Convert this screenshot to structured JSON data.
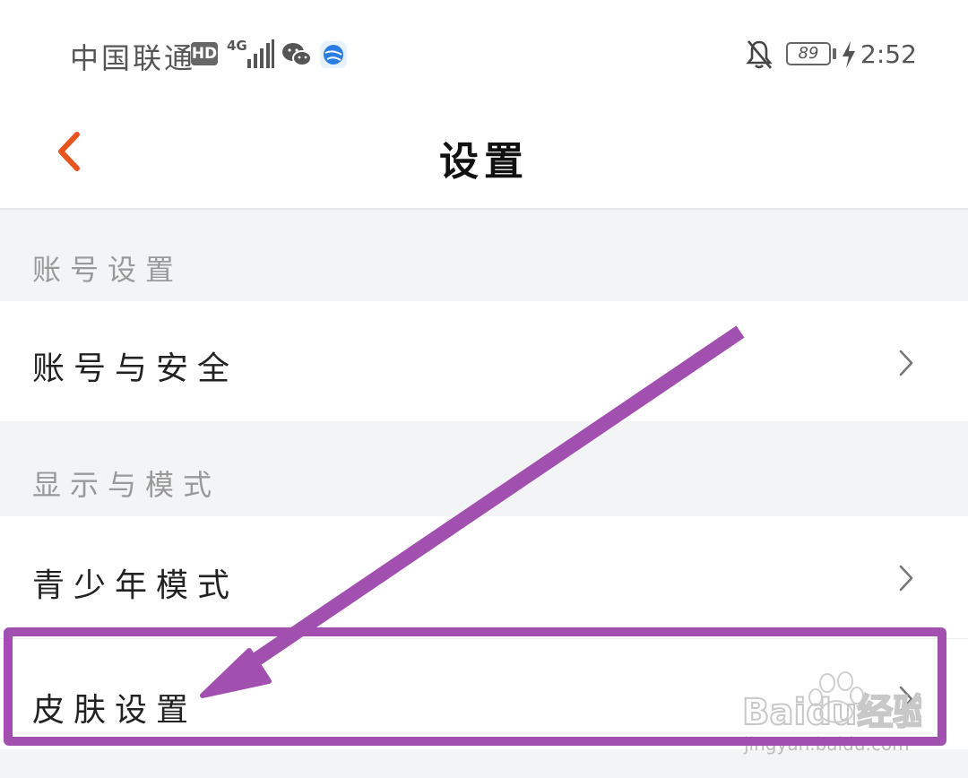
{
  "status_bar": {
    "carrier": "中国联通",
    "hd_badge": "HD",
    "network": "4G",
    "battery": "89",
    "time": "2:52",
    "icons": [
      "signal-icon",
      "wechat-icon",
      "browser-icon",
      "mute-bell-icon",
      "battery-icon",
      "charging-icon"
    ]
  },
  "header": {
    "title": "设置",
    "back_icon": "chevron-left-icon",
    "accent_color": "#e8541e"
  },
  "sections": [
    {
      "header": "账号设置",
      "items": [
        {
          "label": "账号与安全"
        }
      ]
    },
    {
      "header": "显示与模式",
      "items": [
        {
          "label": "青少年模式"
        },
        {
          "label": "皮肤设置"
        }
      ]
    }
  ],
  "annotation": {
    "color": "#a150b0",
    "highlighted_item": "皮肤设置"
  },
  "watermark": {
    "brand": "Baidu经验",
    "url": "jingyan.baidu.com"
  }
}
